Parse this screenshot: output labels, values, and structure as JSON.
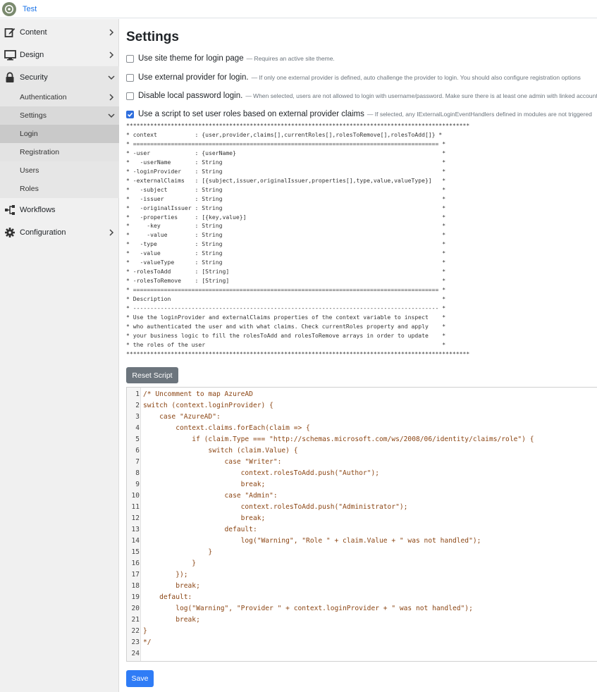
{
  "app": {
    "brand": "Test"
  },
  "sidebar": {
    "items": [
      {
        "label": "Content"
      },
      {
        "label": "Design"
      },
      {
        "label": "Security"
      },
      {
        "label": "Authentication"
      },
      {
        "label": "Settings"
      },
      {
        "label": "Login"
      },
      {
        "label": "Registration"
      },
      {
        "label": "Users"
      },
      {
        "label": "Roles"
      },
      {
        "label": "Workflows"
      },
      {
        "label": "Configuration"
      }
    ]
  },
  "main": {
    "title": "Settings",
    "options": [
      {
        "label": "Use site theme for login page",
        "hint": "— Requires an active site theme.",
        "checked": false
      },
      {
        "label": "Use external provider for login.",
        "hint": "— If only one external provider is defined, auto challenge the provider to login. You should also configure registration options",
        "checked": false
      },
      {
        "label": "Disable local password login.",
        "hint": "— When selected, users are not allowed to login with username/password. Make sure there is at least one admin with linked account",
        "checked": false
      },
      {
        "label": "Use a script to set user roles based on external provider claims",
        "hint": "— If selected, any IExternalLoginEventHandlers defined in modules are not triggered",
        "checked": true
      }
    ],
    "doc_lines": [
      "****************************************************************************************************",
      "* context           : {user,provider,claims[],currentRoles[],rolesToRemove[],rolesToAdd[]} *",
      "* ========================================================================================= *",
      "* -user             : {userName}                                                            *",
      "*   -userName       : String                                                                *",
      "* -loginProvider    : String                                                                *",
      "* -externalClaims   : [{subject,issuer,originalIssuer,properties[],type,value,valueType}]   *",
      "*   -subject        : String                                                                *",
      "*   -issuer         : String                                                                *",
      "*   -originalIssuer : String                                                                *",
      "*   -properties     : [{key,value}]                                                         *",
      "*     -key          : String                                                                *",
      "*     -value        : String                                                                *",
      "*   -type           : String                                                                *",
      "*   -value          : String                                                                *",
      "*   -valueType      : String                                                                *",
      "* -rolesToAdd       : [String]                                                              *",
      "* -rolesToRemove    : [String]                                                              *",
      "* ========================================================================================= *",
      "* Description                                                                               *",
      "* ----------------------------------------------------------------------------------------- *",
      "* Use the loginProvider and externalClaims properties of the context variable to inspect    *",
      "* who authenticated the user and with what claims. Check currentRoles property and apply    *",
      "* your business logic to fill the rolesToAdd and rolesToRemove arrays in order to update    *",
      "* the roles of the user                                                                     *",
      "****************************************************************************************************"
    ],
    "reset_label": "Reset Script",
    "code_lines": [
      "/* Uncomment to map AzureAD",
      "switch (context.loginProvider) {",
      "    case \"AzureAD\":",
      "        context.claims.forEach(claim => {",
      "            if (claim.Type === \"http://schemas.microsoft.com/ws/2008/06/identity/claims/role\") {",
      "                switch (claim.Value) {",
      "                    case \"Writer\":",
      "                        context.rolesToAdd.push(\"Author\");",
      "                        break;",
      "                    case \"Admin\":",
      "                        context.rolesToAdd.push(\"Administrator\");",
      "                        break;",
      "                    default:",
      "                        log(\"Warning\", \"Role \" + claim.Value + \" was not handled\");",
      "                }",
      "            }",
      "        });",
      "        break;",
      "    default:",
      "        log(\"Warning\", \"Provider \" + context.loginProvider + \" was not handled\");",
      "        break;",
      "}",
      "*/",
      ""
    ],
    "line_numbers": [
      "1",
      "2",
      "3",
      "4",
      "5",
      "6",
      "7",
      "8",
      "9",
      "10",
      "11",
      "12",
      "13",
      "14",
      "15",
      "16",
      "17",
      "18",
      "19",
      "20",
      "21",
      "22",
      "23",
      "24"
    ],
    "save_label": "Save"
  },
  "colors": {
    "accent": "#2f7cf6",
    "checkbox_checked": "#2f6fde",
    "secondary_button": "#6c757d",
    "code_text": "#8b4513",
    "sidebar_bg": "#f0f0f0"
  },
  "icons": {
    "logo": "orchard-logo-icon",
    "content": "edit-icon",
    "design": "monitor-icon",
    "security": "lock-icon",
    "workflows": "workflow-icon",
    "configuration": "gear-icon",
    "chevron_right": "chevron-right-icon",
    "chevron_down": "chevron-down-icon"
  }
}
